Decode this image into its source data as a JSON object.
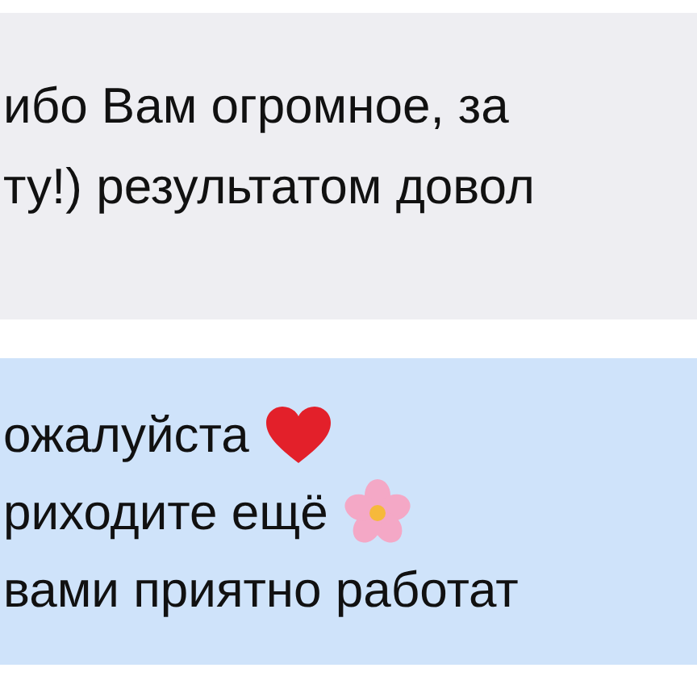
{
  "messages": [
    {
      "kind": "incoming",
      "lines": [
        {
          "kind": "plain",
          "text": "ибо Вам огромное, за"
        },
        {
          "kind": "plain",
          "text": "ту!) результатом довол"
        }
      ]
    },
    {
      "kind": "outgoing",
      "lines": [
        {
          "kind": "heart",
          "text": "ожалуйста"
        },
        {
          "kind": "flower",
          "text": "риходите ещё"
        },
        {
          "kind": "plain",
          "text": "вами приятно работат"
        }
      ]
    }
  ]
}
